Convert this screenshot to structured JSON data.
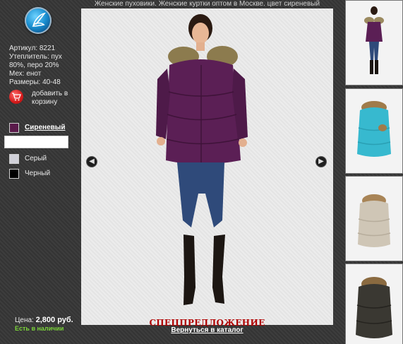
{
  "page_title": "Женские пуховики. Женские куртки оптом в Москве. цвет сиреневый",
  "logo": {
    "icon": "brand-logo-icon"
  },
  "specs": {
    "article": "Артикул: 8221",
    "insulation": "Утеплитель: пух 80%, перо 20%",
    "fur": "Мех: енот",
    "sizes": "Размеры: 40-48"
  },
  "cart": {
    "label": "добавить в корзину",
    "icon": "cart-icon"
  },
  "colors": [
    {
      "name": "Сиреневый",
      "hex": "#5a1a4a",
      "selected": true
    },
    {
      "name": "Серый",
      "hex": "#d0d0d8",
      "selected": false
    },
    {
      "name": "Черный",
      "hex": "#000000",
      "selected": false
    }
  ],
  "price": {
    "label": "Цена:",
    "value": "2,800 руб."
  },
  "stock": "Есть в наличии",
  "main": {
    "special": "СПЕЦПРЕДЛОЖЕНИЕ",
    "back_link": "Вернуться в каталог",
    "prev_icon": "arrow-left-icon",
    "next_icon": "arrow-right-icon"
  },
  "thumbnails": [
    {
      "name": "thumb-lilac-jacket",
      "jacket_color": "#5b1f55",
      "fur_color": "#9b8a60"
    },
    {
      "name": "thumb-turquoise-jacket",
      "jacket_color": "#37b9cf",
      "fur_color": "#a07b4a"
    },
    {
      "name": "thumb-beige-jacket",
      "jacket_color": "#cfc6b6",
      "fur_color": "#a88456"
    },
    {
      "name": "thumb-black-jacket",
      "jacket_color": "#3a3832",
      "fur_color": "#8a6a40"
    }
  ],
  "colors_theme": {
    "accent_red": "#b00000",
    "stock_green": "#7ad23a"
  }
}
